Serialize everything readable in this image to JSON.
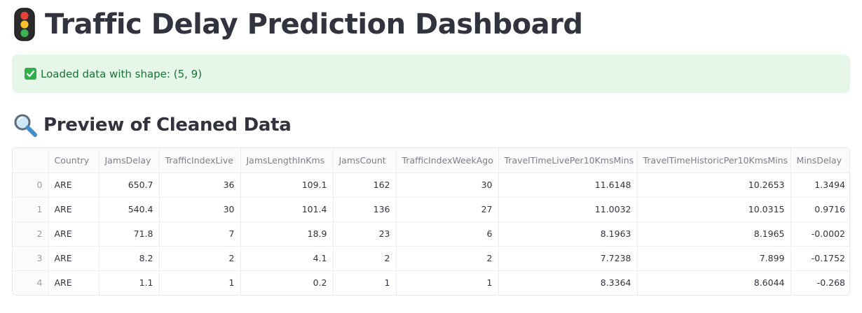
{
  "header": {
    "title": "Traffic Delay Prediction Dashboard",
    "icon": "traffic-light-icon"
  },
  "alert": {
    "text": "Loaded data with shape: (5, 9)",
    "icon": "check-mark-icon",
    "background": "#e6f7ea",
    "text_color": "#177233"
  },
  "section": {
    "title": "Preview of Cleaned Data",
    "icon": "magnifying-glass-icon"
  },
  "table": {
    "columns": [
      "",
      "Country",
      "JamsDelay",
      "TrafficIndexLive",
      "JamsLengthInKms",
      "JamsCount",
      "TrafficIndexWeekAgo",
      "TravelTimeLivePer10KmsMins",
      "TravelTimeHistoricPer10KmsMins",
      "MinsDelay"
    ],
    "rows": [
      [
        "0",
        "ARE",
        "650.7",
        "36",
        "109.1",
        "162",
        "30",
        "11.6148",
        "10.2653",
        "1.3494"
      ],
      [
        "1",
        "ARE",
        "540.4",
        "30",
        "101.4",
        "136",
        "27",
        "11.0032",
        "10.0315",
        "0.9716"
      ],
      [
        "2",
        "ARE",
        "71.8",
        "7",
        "18.9",
        "23",
        "6",
        "8.1963",
        "8.1965",
        "-0.0002"
      ],
      [
        "3",
        "ARE",
        "8.2",
        "2",
        "4.1",
        "2",
        "2",
        "7.7238",
        "7.899",
        "-0.1752"
      ],
      [
        "4",
        "ARE",
        "1.1",
        "1",
        "0.2",
        "1",
        "1",
        "8.3364",
        "8.6044",
        "-0.268"
      ]
    ]
  }
}
